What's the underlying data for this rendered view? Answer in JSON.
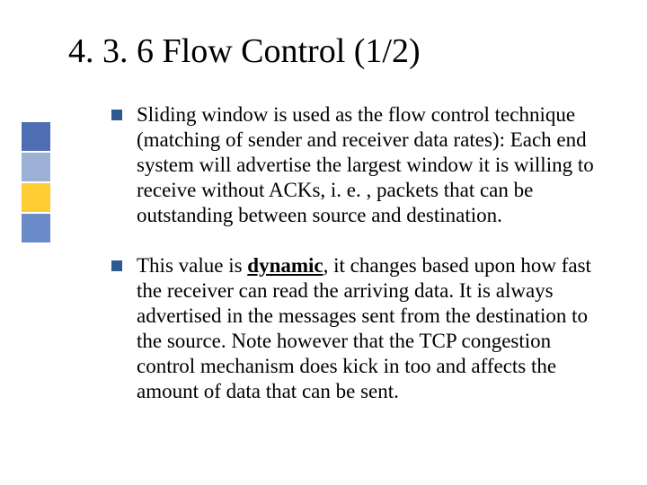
{
  "slide": {
    "title": "4. 3. 6 Flow Control (1/2)",
    "bullets": [
      {
        "before": "Sliding window is used as the flow control technique (matching of sender and receiver data rates): Each end system will advertise the largest window it is willing to receive without ACKs, i. e. , packets that can be outstanding between source and destination.",
        "emph": "",
        "after": ""
      },
      {
        "before": "This value is ",
        "emph": "dynamic",
        "after": ", it changes based upon how fast the receiver can read the arriving data. It is always advertised in the messages sent from the destination to the source. Note however that the TCP congestion control mechanism does kick in too and affects the amount of data that can be sent."
      }
    ]
  }
}
